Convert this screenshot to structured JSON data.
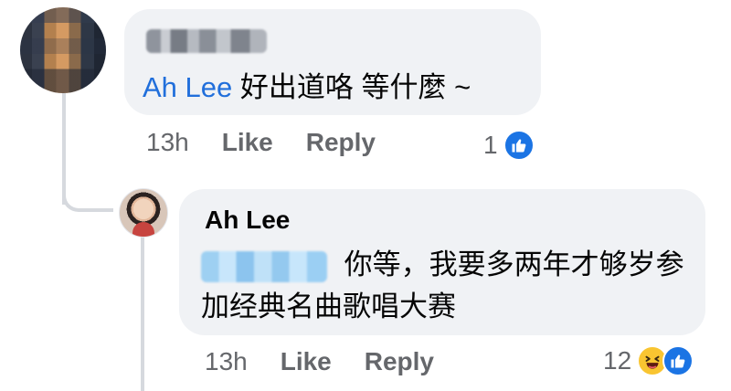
{
  "comment_1": {
    "author": "",
    "mention": "Ah Lee",
    "text": "好出道咯 等什麼 ~",
    "time": "13h",
    "like_label": "Like",
    "reply_label": "Reply",
    "reaction_count": "1",
    "reaction_icon": "like-icon",
    "colors": {
      "mention": "#216fdb",
      "like": "#1b74e4"
    }
  },
  "comment_2": {
    "author": "Ah Lee",
    "mention": "",
    "text": "你等，我要多两年才够岁参加经典名曲歌唱大赛",
    "time": "13h",
    "like_label": "Like",
    "reply_label": "Reply",
    "reaction_count": "12",
    "reaction_icons": [
      "haha-icon",
      "like-icon"
    ],
    "colors": {
      "mention": "#216fdb",
      "haha": "#f9c531",
      "like": "#1b74e4"
    }
  }
}
